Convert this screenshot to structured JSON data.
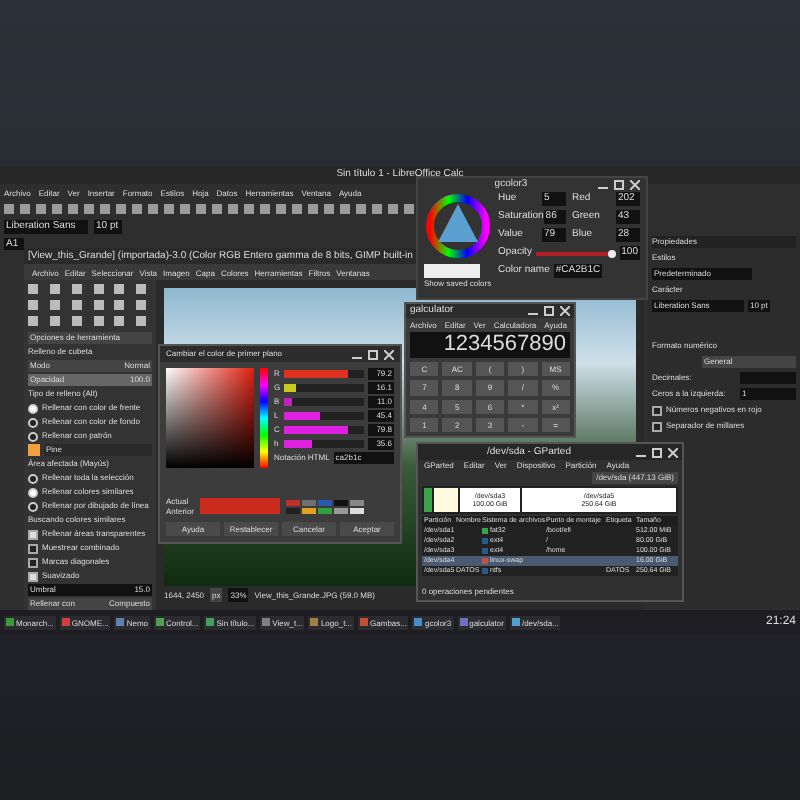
{
  "libreoffice": {
    "title": "Sin título 1 - LibreOffice Calc",
    "menu": [
      "Archivo",
      "Editar",
      "Ver",
      "Insertar",
      "Formato",
      "Estilos",
      "Hoja",
      "Datos",
      "Herramientas",
      "Ventana",
      "Ayuda"
    ],
    "font_name": "Liberation Sans",
    "font_size": "10 pt",
    "cell_ref": "A1"
  },
  "gimp": {
    "title": "[View_this_Grande] (importada)-3.0 (Color RGB Entero gamma de 8 bits, GIMP built-in",
    "menu": [
      "Archivo",
      "Editar",
      "Seleccionar",
      "Vista",
      "Imagen",
      "Capa",
      "Colores",
      "Herramientas",
      "Filtros",
      "Ventanas"
    ],
    "tool_options": {
      "header": "Opciones de herramienta",
      "section": "Relleno de cubeta",
      "mode_label": "Modo",
      "mode": "Normal",
      "opacity_label": "Opacidad",
      "opacity": "100.0",
      "fill_type_label": "Tipo de relleno (Alt)",
      "fill_options": [
        {
          "label": "Rellenar con color de frente",
          "selected": true
        },
        {
          "label": "Rellenar con color de fondo",
          "selected": false
        },
        {
          "label": "Rellenar con patrón",
          "selected": false
        }
      ],
      "pattern": "Pine",
      "area_label": "Área afectada (Mayús)",
      "area_options": [
        {
          "label": "Rellenar toda la selección",
          "selected": false
        },
        {
          "label": "Rellenar colores similares",
          "selected": true
        },
        {
          "label": "Rellenar por dibujado de línea",
          "selected": false
        }
      ],
      "similar_label": "Buscando colores similares",
      "checks": [
        {
          "label": "Rellenar áreas transparentes",
          "checked": true
        },
        {
          "label": "Muestrear combinado",
          "checked": false
        },
        {
          "label": "Marcas diagonales",
          "checked": false
        },
        {
          "label": "Suavizado",
          "checked": true
        }
      ],
      "threshold_label": "Umbral",
      "threshold": "15.0",
      "fill_by_label": "Rellenar con",
      "fill_by": "Compuesto"
    },
    "status": {
      "coords": "1644, 2450",
      "unit": "px",
      "zoom": "33%",
      "file": "View_this_Grande.JPG (59.0 MB)"
    }
  },
  "color_dialog": {
    "title": "Cambiar el color de primer plano",
    "channels": [
      {
        "name": "R",
        "level": 0.79,
        "value": "79.2",
        "color": "#e03020"
      },
      {
        "name": "G",
        "level": 0.16,
        "value": "16.1",
        "color": "#c8c820"
      },
      {
        "name": "B",
        "level": 0.11,
        "value": "11.0",
        "color": "#c020c0"
      },
      {
        "name": "L",
        "level": 0.45,
        "value": "45.4",
        "color": "#e020e0"
      },
      {
        "name": "C",
        "level": 0.79,
        "value": "79.8",
        "color": "#e020e0"
      },
      {
        "name": "h",
        "level": 0.35,
        "value": "35.6",
        "color": "#e020e0"
      }
    ],
    "html_label": "Notación HTML",
    "html_value": "ca2b1c",
    "current_label": "Actual",
    "previous_label": "Anterior",
    "swatches": [
      {
        "color": "#c0302a"
      },
      {
        "color": "#707070"
      },
      {
        "color": "#2a5ab0"
      },
      {
        "color": "#111111"
      },
      {
        "color": "#888888"
      },
      {
        "color": "#202020"
      },
      {
        "color": "#e0a020"
      },
      {
        "color": "#30a040"
      },
      {
        "color": "#999999"
      },
      {
        "color": "#dddddd"
      }
    ],
    "buttons": [
      "Ayuda",
      "Restablecer",
      "Cancelar",
      "Aceptar"
    ]
  },
  "gcolor": {
    "title": "gcolor3",
    "fields": [
      {
        "label": "Hue",
        "value": "5"
      },
      {
        "label": "Red",
        "value": "202"
      },
      {
        "label": "Saturation",
        "value": "86"
      },
      {
        "label": "Green",
        "value": "43"
      },
      {
        "label": "Value",
        "value": "79"
      },
      {
        "label": "Blue",
        "value": "28"
      }
    ],
    "opacity_label": "Opacity",
    "opacity_slider": {
      "level": 1
    },
    "opacity": "100",
    "name_label": "Color name",
    "name_value": "#CA2B1C",
    "saved_label": "Show saved colors"
  },
  "calculator": {
    "title": "galculator",
    "menu": [
      "Archivo",
      "Editar",
      "Ver",
      "Calculadora",
      "Ayuda"
    ],
    "display": "1234567890",
    "keys": [
      "C",
      "AC",
      "(",
      ")",
      "MS",
      "7",
      "8",
      "9",
      "/",
      "%",
      "4",
      "5",
      "6",
      "*",
      "x²",
      "1",
      "2",
      "3",
      "-",
      "="
    ]
  },
  "gparted": {
    "title": "/dev/sda - GParted",
    "menu": [
      "GParted",
      "Editar",
      "Ver",
      "Dispositivo",
      "Partición",
      "Ayuda"
    ],
    "device": "/dev/sda (447.13 GiB)",
    "segments": [
      {
        "label": "/dev/sda3",
        "size": "100.00 GiB"
      },
      {
        "label": "/dev/sda5",
        "size": "250.64 GiB"
      }
    ],
    "columns": [
      "Partición",
      "Nombre",
      "Sistema de archivos",
      "Punto de montaje",
      "Etiqueta",
      "Tamaño"
    ],
    "rows": [
      {
        "partition": "/dev/sda1",
        "fs": "fat32",
        "mount": "/boot/efi",
        "size": "512.00 MiB",
        "color": "#3aa34a",
        "selected": false
      },
      {
        "partition": "/dev/sda2",
        "fs": "ext4",
        "mount": "/",
        "size": "80.00 GiB",
        "color": "#2a5a8a",
        "selected": false
      },
      {
        "partition": "/dev/sda3",
        "fs": "ext4",
        "mount": "/home",
        "size": "100.00 GiB",
        "color": "#2a5a8a",
        "selected": false
      },
      {
        "partition": "/dev/sda4",
        "fs": "linux-swap",
        "size": "16.00 GiB",
        "color": "#c0504d",
        "selected": true
      },
      {
        "partition": "/dev/sda5",
        "name": "DATOS",
        "fs": "ntfs",
        "label": "DATOS",
        "size": "250.64 GiB",
        "color": "#2a5a8a",
        "selected": false
      }
    ],
    "status": "0 operaciones pendientes"
  },
  "properties": {
    "title": "Propiedades",
    "styles_label": "Estilos",
    "style": "Predeterminado",
    "char_label": "Carácter",
    "font": "Liberation Sans",
    "font_size": "10 pt",
    "number_label": "Formato numérico",
    "format": "General",
    "decimals_label": "Decimales:",
    "leading_label": "Ceros a la izquierda:",
    "leading": "1",
    "checks": [
      {
        "label": "Números negativos en rojo",
        "checked": false
      },
      {
        "label": "Separador de millares",
        "checked": false
      }
    ]
  },
  "taskbar": {
    "items": [
      {
        "label": "Monarch...",
        "color": "#3a9a3a"
      },
      {
        "label": "GNOME...",
        "color": "#d04040"
      },
      {
        "label": "Nemo",
        "color": "#6080b0"
      },
      {
        "label": "Control...",
        "color": "#50a050"
      },
      {
        "label": "Sin título...",
        "color": "#40a060"
      },
      {
        "label": "View_t...",
        "color": "#808080"
      },
      {
        "label": "Logo_t...",
        "color": "#a08040"
      },
      {
        "label": "Gambas...",
        "color": "#c05030"
      },
      {
        "label": "gcolor3",
        "color": "#4090d0"
      },
      {
        "label": "galculator",
        "color": "#7070c0"
      },
      {
        "label": "/dev/sda...",
        "color": "#50a0d0"
      }
    ],
    "time": "21:24"
  }
}
